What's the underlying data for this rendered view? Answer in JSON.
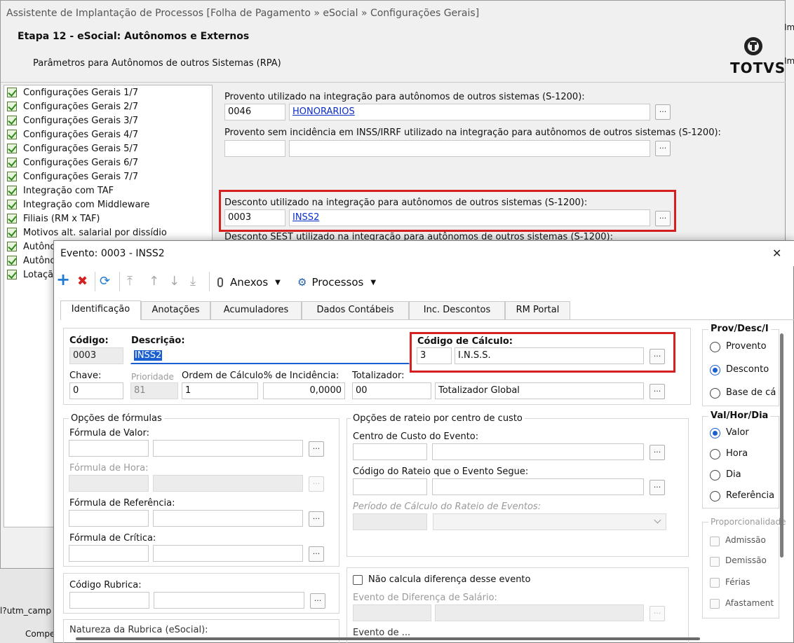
{
  "bg_window": {
    "title": "Assistente de Implantação de Processos [Folha de Pagamento » eSocial » Configurações Gerais]",
    "step_title": "Etapa 12 - eSocial: Autônomos e Externos",
    "step_subtitle": "Parâmetros para Autônomos de outros Sistemas (RPA)",
    "logo_text": "TOTVS",
    "tree_items": [
      "Configurações Gerais 1/7",
      "Configurações Gerais 2/7",
      "Configurações Gerais 3/7",
      "Configurações Gerais 4/7",
      "Configurações Gerais 5/7",
      "Configurações Gerais 6/7",
      "Configurações Gerais 7/7",
      "Integração com TAF",
      "Integração com Middleware",
      "Filiais (RM x TAF)",
      "Motivos alt. salarial por dissídio",
      "Autônc",
      "Autônc",
      "Lotaçã"
    ],
    "fields": {
      "provento_label": "Provento utilizado na integração para autônomos de outros sistemas (S-1200):",
      "provento_code": "0046",
      "provento_desc": "HONORARIOS",
      "provento_sem_label": "Provento sem incidência em INSS/IRRF utilizado na integração para autônomos de outros sistemas (S-1200):",
      "desconto_label": "Desconto utilizado na integração para autônomos de outros sistemas (S-1200):",
      "desconto_code": "0003",
      "desconto_desc": "INSS2",
      "desconto_sest_label": "Desconto SEST utilizado na integração para autônomos de outros sistemas (S-1200):"
    },
    "browse_btn": "...",
    "right_edge": [
      "Im",
      "Im"
    ],
    "bottom_left": [
      "l?utm_camp",
      "Compe"
    ]
  },
  "dialog": {
    "title": "Evento: 0003 - INSS2",
    "close_glyph": "✕",
    "toolbar": {
      "add": "+",
      "delete": "✖",
      "refresh": "⟳",
      "first": "⤒",
      "up": "↑",
      "down": "↓",
      "last": "⤓",
      "anexos": "Anexos",
      "processos": "Processos",
      "dropdown_glyph": "▼"
    },
    "tabs": [
      "Identificação",
      "Anotações",
      "Acumuladores",
      "Dados Contábeis",
      "Inc. Descontos",
      "RM Portal"
    ],
    "codigo_label": "Código:",
    "codigo_value": "0003",
    "descricao_label": "Descrição:",
    "descricao_value": "INSS2",
    "codigo_calculo_label": "Código de Cálculo:",
    "codigo_calculo_code": "3",
    "codigo_calculo_desc": "I.N.S.S.",
    "chave_label": "Chave:",
    "chave_value": "0",
    "prioridade_label": "Prioridade",
    "prioridade_value": "81",
    "ordem_label": "Ordem de Cálculo:",
    "ordem_value": "1",
    "incidencia_label": "% de Incidência:",
    "incidencia_value": "0,0000",
    "totalizador_label": "Totalizador:",
    "totalizador_code": "00",
    "totalizador_desc": "Totalizador Global",
    "formulas_group": "Opções de fórmulas",
    "formula_valor": "Fórmula de Valor:",
    "formula_hora": "Fórmula de Hora:",
    "formula_referencia": "Fórmula de Referência:",
    "formula_critica": "Fórmula de Crítica:",
    "rateio_group": "Opções de rateio por centro de custo",
    "centro_custo": "Centro de Custo do Evento:",
    "codigo_rateio": "Código do Rateio que o Evento Segue:",
    "periodo_rateio": "Período de Cálculo do Rateio de Eventos:",
    "codigo_rubrica": "Código Rubrica:",
    "natureza_rubrica": "Natureza da Rubrica (eSocial):",
    "nao_calcula": "Não calcula diferença desse evento",
    "evento_diferenca": "Evento de Diferença de Salário:",
    "evento_cut": "Evento de ...",
    "prov_desc_group": "Prov/Desc/I",
    "prov_options": [
      "Provento",
      "Desconto",
      "Base de cá"
    ],
    "prov_selected": 1,
    "val_group": "Val/Hor/Dia",
    "val_options": [
      "Valor",
      "Hora",
      "Dia",
      "Referência"
    ],
    "val_selected": 0,
    "proporcional_group": "Proporcionalidade",
    "proporcional_options": [
      "Admissão",
      "Demissão",
      "Férias",
      "Afastament"
    ]
  },
  "colors": {
    "accent": "#1a5fd1",
    "highlight": "#d42020",
    "link": "#0a2ec7"
  }
}
